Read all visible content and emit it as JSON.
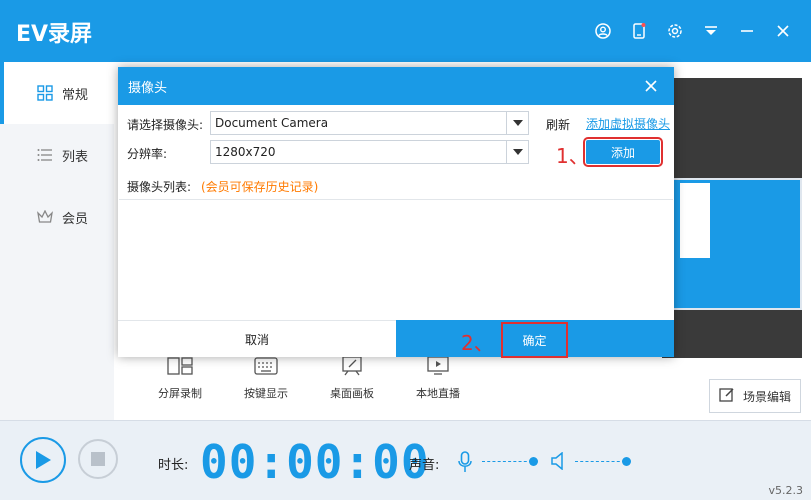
{
  "app": {
    "title": "EV录屏",
    "version": "v5.2.3"
  },
  "titlebar_icons": [
    "account-icon",
    "phone-icon",
    "settings-icon",
    "menu-icon",
    "minimize-icon",
    "close-icon"
  ],
  "sidebar": {
    "items": [
      {
        "label": "常规",
        "icon": "grid-icon",
        "active": true
      },
      {
        "label": "列表",
        "icon": "list-icon",
        "active": false
      },
      {
        "label": "会员",
        "icon": "crown-icon",
        "active": false
      }
    ]
  },
  "tools": [
    {
      "label": "分屏录制",
      "icon": "split-screen-icon"
    },
    {
      "label": "按键显示",
      "icon": "keyboard-icon"
    },
    {
      "label": "桌面画板",
      "icon": "whiteboard-icon"
    },
    {
      "label": "本地直播",
      "icon": "live-stream-icon"
    }
  ],
  "scene_button": "场景编辑",
  "bottom": {
    "duration_label": "时长:",
    "timer": "00:00:00",
    "sound_label": "声音:"
  },
  "dialog": {
    "title": "摄像头",
    "camera_label": "请选择摄像头:",
    "camera_value": "Document Camera",
    "refresh": "刷新",
    "add_virtual": "添加虚拟摄像头",
    "resolution_label": "分辨率:",
    "resolution_value": "1280x720",
    "add_button": "添加",
    "list_label": "摄像头列表:",
    "list_note": "(会员可保存历史记录)",
    "cancel": "取消",
    "confirm": "确定"
  },
  "annotations": {
    "step1": "1、",
    "step2": "2、"
  },
  "colors": {
    "accent": "#1a9ae6",
    "highlight": "#e03030",
    "note": "#ff7a00"
  }
}
